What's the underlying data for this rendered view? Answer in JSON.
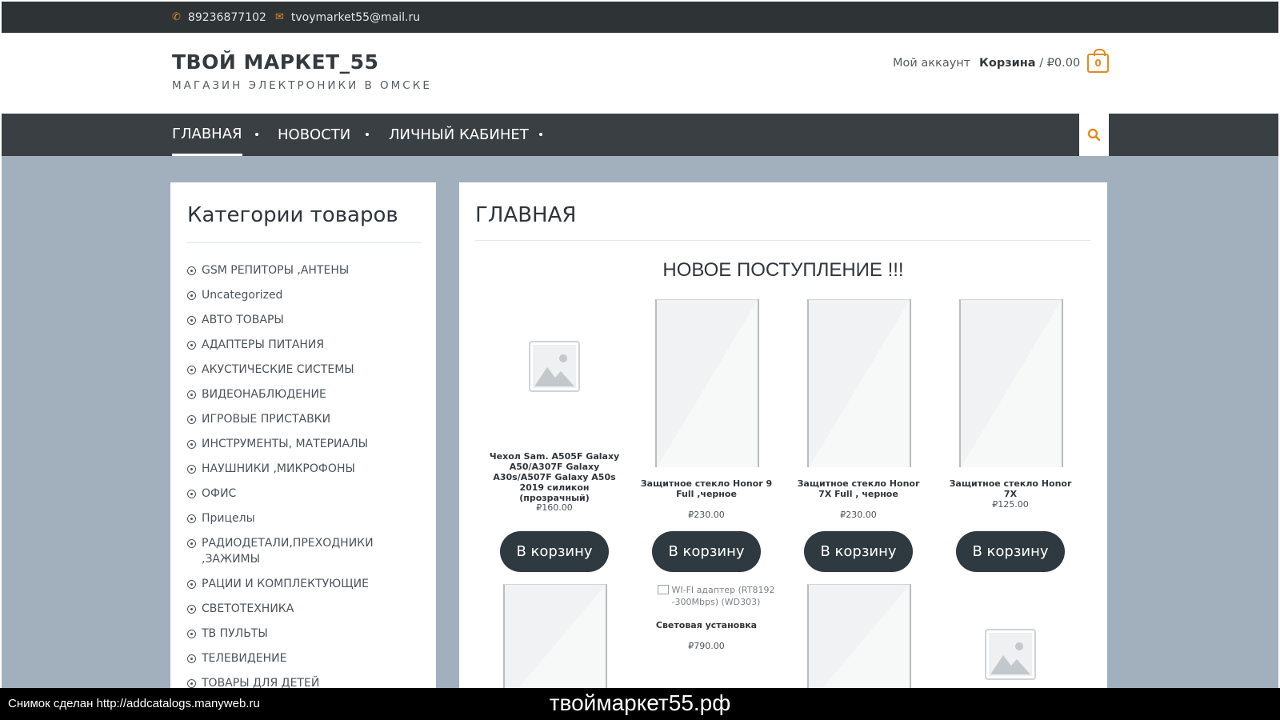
{
  "topbar": {
    "phone_icon": "phone-icon",
    "phone": "89236877102",
    "email_icon": "envelope-icon",
    "email": "tvoymarket55@mail.ru"
  },
  "header": {
    "site_title": "ТВОЙ МАРКЕТ_55",
    "tagline": "МАГАЗИН ЭЛЕКТРОНИКИ В ОМСКЕ",
    "account_label": "Мой аккаунт",
    "cart_label": "Корзина",
    "cart_separator": " / ",
    "cart_total": "₽0.00",
    "cart_count": "0",
    "accent_color": "#e58a1f"
  },
  "nav": {
    "items": [
      {
        "label": "ГЛАВНАЯ",
        "active": true
      },
      {
        "label": "НОВОСТИ",
        "active": false
      },
      {
        "label": "ЛИЧНЫЙ КАБИНЕТ",
        "active": false
      }
    ],
    "search_icon": "search-icon"
  },
  "sidebar": {
    "title": "Категории товаров",
    "categories": [
      "GSM РЕПИТОРЫ ,АНТЕНЫ",
      "Uncategorized",
      "АВТО ТОВАРЫ",
      "АДАПТЕРЫ ПИТАНИЯ",
      "АКУСТИЧЕСКИЕ СИСТЕМЫ",
      "ВИДЕОНАБЛЮДЕНИЕ",
      "ИГРОВЫЕ ПРИСТАВКИ",
      "ИНСТРУМЕНТЫ, МАТЕРИАЛЫ",
      "НАУШНИКИ ,МИКРОФОНЫ",
      "ОФИС",
      "Прицелы",
      "РАДИОДЕТАЛИ,ПРЕХОДНИКИ ,ЗАЖИМЫ",
      "РАЦИИ И КОМПЛЕКТУЮЩИЕ",
      "СВЕТОТЕХНИКА",
      "ТВ ПУЛЬТЫ",
      "ТЕЛЕВИДЕНИЕ",
      "ТОВАРЫ ДЛЯ ДЕТЕЙ"
    ]
  },
  "main": {
    "page_title": "ГЛАВНАЯ",
    "section_title": "НОВОЕ ПОСТУПЛЕНИЕ !!!",
    "add_to_cart_label": "В корзину",
    "products": [
      {
        "name": "Чехол Sam. A505F Galaxy A50/A307F Galaxy A30s/A507F Galaxy A50s 2019 силикон (прозрачный)",
        "price": "₽160.00"
      },
      {
        "name": "Защитное стекло Honor 9 Full ,черное",
        "price": "₽230.00"
      },
      {
        "name": "Защитное стекло Honor 7X Full , черное",
        "price": "₽230.00"
      },
      {
        "name": "Защитное стекло Honor 7X",
        "price": "₽125.00"
      }
    ],
    "row2": {
      "broken_image_alt": "WI-FI адаптер (RT8192 -300Mbps) (WD303)",
      "product_name": "Световая установка",
      "product_price": "₽790.00"
    }
  },
  "footer_bar": {
    "credit": "Снимок сделан http://addcatalogs.manyweb.ru",
    "domain": "твоймаркет55.рф"
  }
}
